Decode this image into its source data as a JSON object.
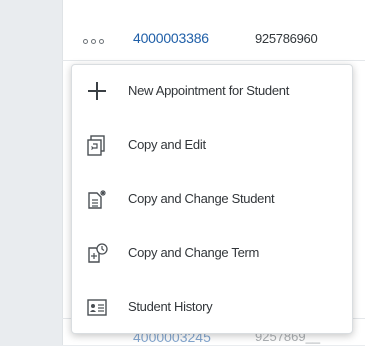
{
  "row": {
    "id": "4000003386",
    "number": "925786960"
  },
  "bottom_row": {
    "id": "4000003245",
    "number": "9257869__"
  },
  "menu": {
    "items": [
      {
        "label": "New Appointment for Student",
        "icon": "plus-icon"
      },
      {
        "label": "Copy and Edit",
        "icon": "copy-edit-icon"
      },
      {
        "label": "Copy and Change Student",
        "icon": "copy-change-student-icon"
      },
      {
        "label": "Copy and Change Term",
        "icon": "copy-change-term-icon"
      },
      {
        "label": "Student History",
        "icon": "student-history-icon"
      }
    ]
  },
  "colors": {
    "link": "#1f5fa8",
    "text": "#32363a",
    "icon": "#4a4f54"
  }
}
